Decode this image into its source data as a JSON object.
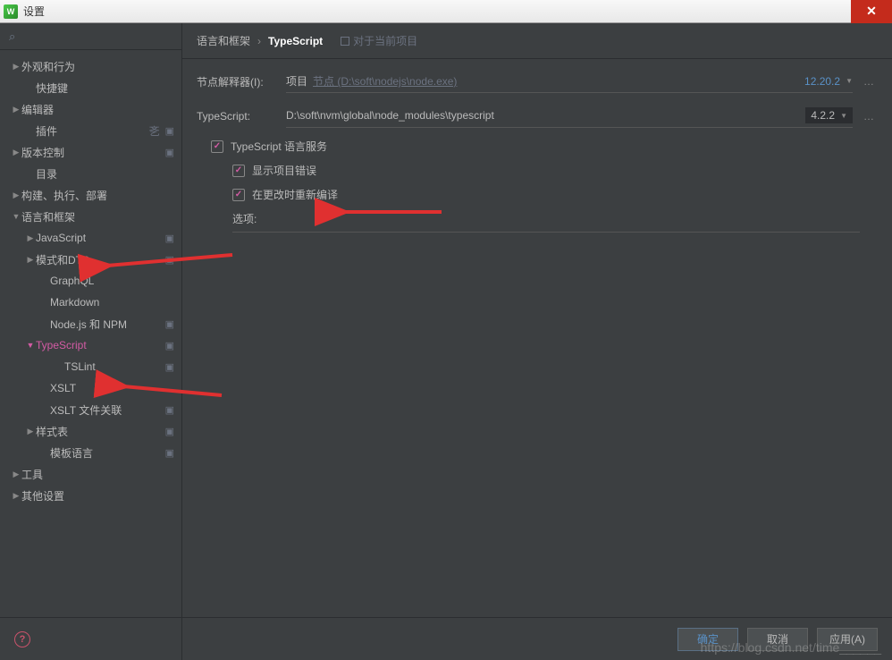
{
  "window": {
    "title": "设置"
  },
  "sidebar": {
    "items": [
      {
        "label": "外观和行为",
        "caret": "▶",
        "level": 0
      },
      {
        "label": "快捷键",
        "caret": "",
        "level": 1
      },
      {
        "label": "编辑器",
        "caret": "▶",
        "level": 0
      },
      {
        "label": "插件",
        "caret": "",
        "level": 1,
        "lang": true,
        "badge": "▣"
      },
      {
        "label": "版本控制",
        "caret": "▶",
        "level": 0,
        "badge": "▣"
      },
      {
        "label": "目录",
        "caret": "",
        "level": 1
      },
      {
        "label": "构建、执行、部署",
        "caret": "▶",
        "level": 0
      },
      {
        "label": "语言和框架",
        "caret": "▼",
        "level": 0,
        "expanded": true
      },
      {
        "label": "JavaScript",
        "caret": "▶",
        "level": 1,
        "badge": "▣"
      },
      {
        "label": "模式和DTD",
        "caret": "▶",
        "level": 1,
        "badge": "▣"
      },
      {
        "label": "GraphQL",
        "caret": "",
        "level": 2
      },
      {
        "label": "Markdown",
        "caret": "",
        "level": 2
      },
      {
        "label": "Node.js 和 NPM",
        "caret": "",
        "level": 2,
        "badge": "▣"
      },
      {
        "label": "TypeScript",
        "caret": "▼",
        "level": 1,
        "selected": true,
        "badge": "▣"
      },
      {
        "label": "TSLint",
        "caret": "",
        "level": 3,
        "badge": "▣"
      },
      {
        "label": "XSLT",
        "caret": "",
        "level": 2
      },
      {
        "label": "XSLT 文件关联",
        "caret": "",
        "level": 2,
        "badge": "▣"
      },
      {
        "label": "样式表",
        "caret": "▶",
        "level": 1,
        "badge": "▣"
      },
      {
        "label": "模板语言",
        "caret": "",
        "level": 2,
        "badge": "▣"
      },
      {
        "label": "工具",
        "caret": "▶",
        "level": 0
      },
      {
        "label": "其他设置",
        "caret": "▶",
        "level": 0
      }
    ]
  },
  "breadcrumb": {
    "root": "语言和框架",
    "current": "TypeScript",
    "badge": "对于当前项目"
  },
  "form": {
    "node_label": "节点解释器(I):",
    "node_project": "项目",
    "node_hint": "节点 (D:\\soft\\nodejs\\node.exe)",
    "node_version": "12.20.2",
    "ts_label": "TypeScript:",
    "ts_path": "D:\\soft\\nvm\\global\\node_modules\\typescript",
    "ts_version": "4.2.2",
    "cb_service": "TypeScript 语言服务",
    "cb_errors": "显示项目错误",
    "cb_recompile": "在更改时重新编译",
    "options": "选项:"
  },
  "buttons": {
    "ok": "确定",
    "cancel": "取消",
    "apply": "应用(A)"
  },
  "watermark": "https://blog.csdn.net/time______"
}
